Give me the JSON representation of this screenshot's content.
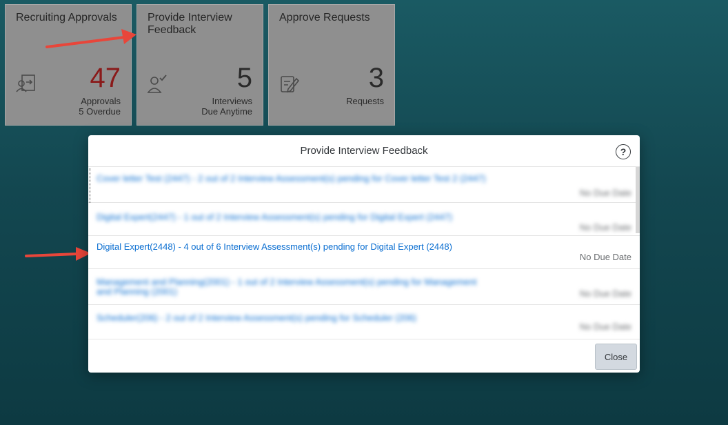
{
  "tiles": [
    {
      "title": "Recruiting Approvals",
      "icon": "approvals-icon",
      "number": "47",
      "number_color": "#8a1a1a",
      "unit_line1": "Approvals",
      "unit_line2": "5 Overdue"
    },
    {
      "title": "Provide Interview Feedback",
      "icon": "interview-user-check-icon",
      "number": "5",
      "unit_line1": "Interviews",
      "unit_line2": "Due Anytime"
    },
    {
      "title": "Approve Requests",
      "icon": "document-edit-icon",
      "number": "3",
      "unit_line1": "Requests",
      "unit_line2": ""
    }
  ],
  "dialog": {
    "title": "Provide Interview Feedback",
    "help_icon": "?",
    "items": [
      {
        "text": "Cover letter Test (2447) - 2 out of 2 Interview Assessment(s) pending for Cover letter Test 2 (2447)",
        "due": "No Due Date",
        "blurred": true
      },
      {
        "text": "Digital Expert(2447) - 1 out of 2 Interview Assessment(s) pending for Digital Expert (2447)",
        "due": "No Due Date",
        "blurred": true
      },
      {
        "text": "Digital Expert(2448) - 4 out of 6 Interview Assessment(s) pending for Digital Expert (2448)",
        "due": "No Due Date",
        "blurred": false
      },
      {
        "text": "Management and Planning(2001) - 1 out of 2 Interview Assessment(s) pending for Management and Planning (2001)",
        "due": "No Due Date",
        "blurred": true
      },
      {
        "text": "Scheduler(206) - 2 out of 2 Interview Assessment(s) pending for Scheduler (206)",
        "due": "No Due Date",
        "blurred": true
      }
    ],
    "close_label": "Close"
  },
  "colors": {
    "accent": "#0a6ed1",
    "annotation_arrow": "#e8463a",
    "tile_bg": "#8f8f8f"
  }
}
